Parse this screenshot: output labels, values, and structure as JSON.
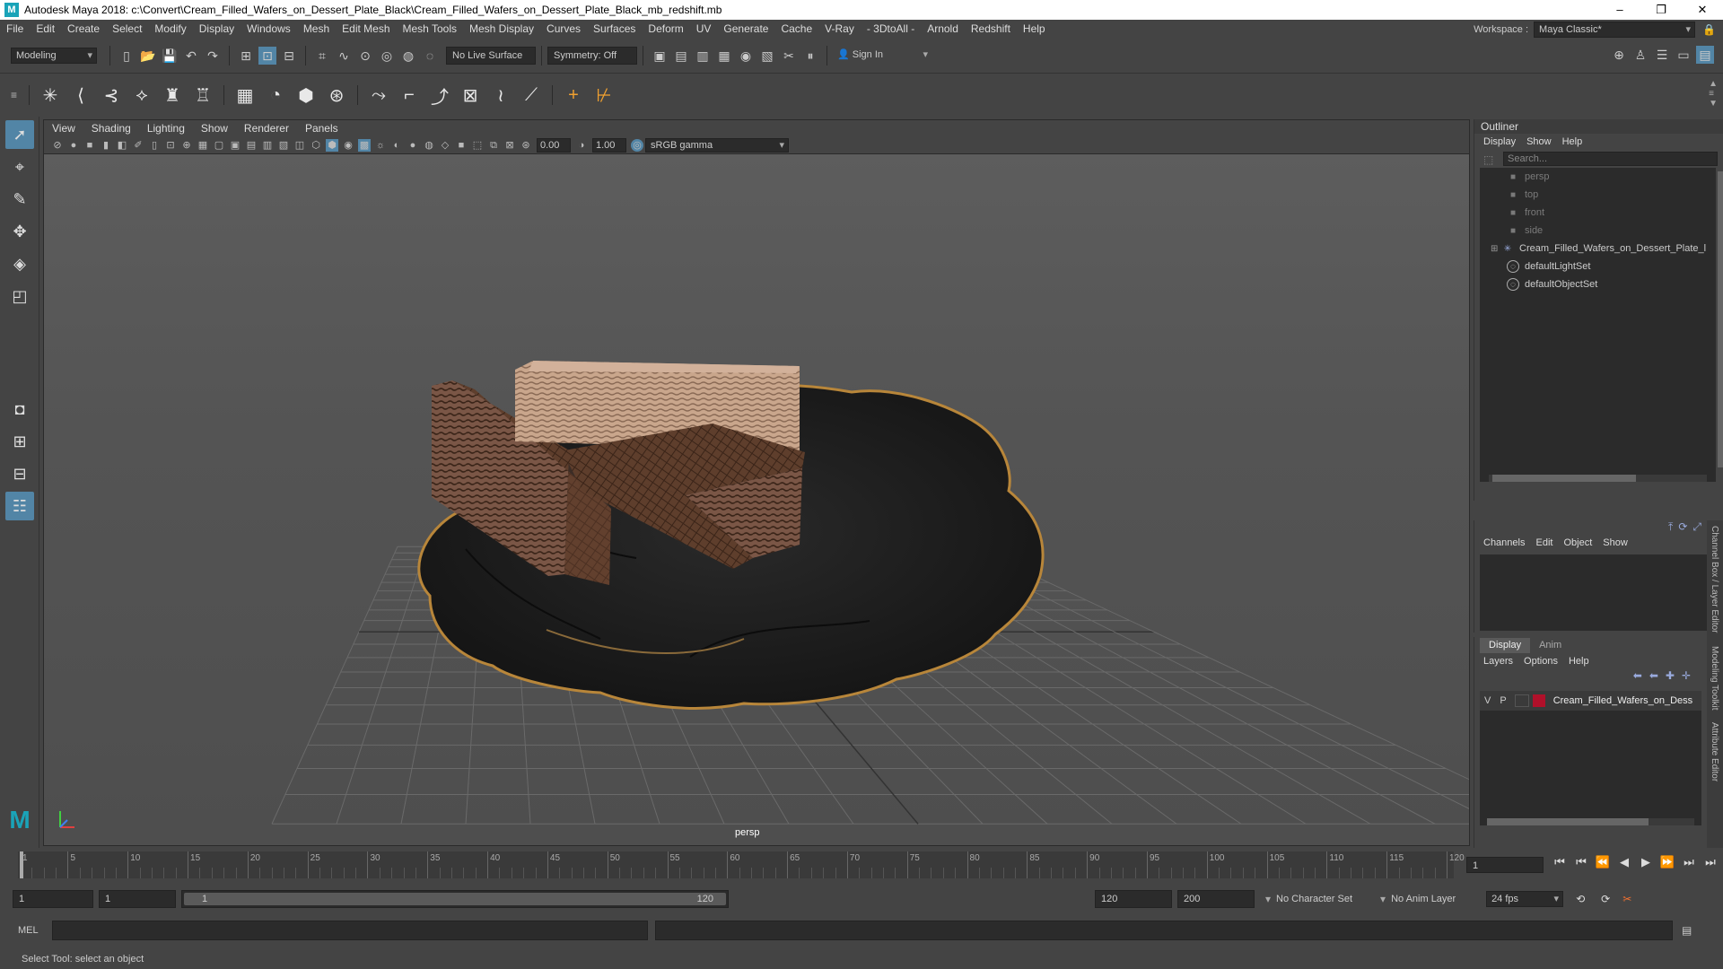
{
  "title_bar": {
    "title": "Autodesk Maya 2018: c:\\Convert\\Cream_Filled_Wafers_on_Dessert_Plate_Black\\Cream_Filled_Wafers_on_Dessert_Plate_Black_mb_redshift.mb",
    "minimize": "–",
    "maximize": "❐",
    "close": "✕"
  },
  "menubar": {
    "items": [
      "File",
      "Edit",
      "Create",
      "Select",
      "Modify",
      "Display",
      "Windows",
      "Mesh",
      "Edit Mesh",
      "Mesh Tools",
      "Mesh Display",
      "Curves",
      "Surfaces",
      "Deform",
      "UV",
      "Generate",
      "Cache",
      "V-Ray",
      "- 3DtoAll -",
      "Arnold",
      "Redshift",
      "Help"
    ],
    "workspace_label": "Workspace :",
    "workspace_value": "Maya Classic*"
  },
  "status_line": {
    "menuset": "Modeling",
    "live_surface": "No Live Surface",
    "symmetry": "Symmetry: Off",
    "sign_in": "Sign In"
  },
  "viewport": {
    "menu": [
      "View",
      "Shading",
      "Lighting",
      "Show",
      "Renderer",
      "Panels"
    ],
    "exposure": "0.00",
    "gamma": "1.00",
    "color_space": "sRGB gamma",
    "camera_label": "persp"
  },
  "outliner": {
    "title": "Outliner",
    "menu": [
      "Display",
      "Show",
      "Help"
    ],
    "search_placeholder": "Search...",
    "items": [
      {
        "label": "persp",
        "icon": "camera-icon"
      },
      {
        "label": "top",
        "icon": "camera-icon"
      },
      {
        "label": "front",
        "icon": "camera-icon"
      },
      {
        "label": "side",
        "icon": "camera-icon"
      },
      {
        "label": "Cream_Filled_Wafers_on_Dessert_Plate_l",
        "icon": "group-icon"
      },
      {
        "label": "defaultLightSet",
        "icon": "set-icon"
      },
      {
        "label": "defaultObjectSet",
        "icon": "set-icon"
      }
    ]
  },
  "channel_box": {
    "menu": [
      "Channels",
      "Edit",
      "Object",
      "Show"
    ]
  },
  "layer_editor": {
    "tabs": [
      "Display",
      "Anim"
    ],
    "menu": [
      "Layers",
      "Options",
      "Help"
    ],
    "layer": {
      "v": "V",
      "p": "P",
      "name": "Cream_Filled_Wafers_on_Dess",
      "color": "#b0102a"
    }
  },
  "side_tabs": [
    "Channel Box / Layer Editor",
    "Modeling Toolkit",
    "Attribute Editor"
  ],
  "time_slider": {
    "ticks": [
      1,
      5,
      10,
      15,
      20,
      25,
      30,
      35,
      40,
      45,
      50,
      55,
      60,
      65,
      70,
      75,
      80,
      85,
      90,
      95,
      100,
      105,
      110,
      115,
      120
    ],
    "current_frame": "1"
  },
  "range": {
    "start": "1",
    "playback_start": "1",
    "slider_start": "1",
    "slider_end": "120",
    "playback_end": "120",
    "end": "200",
    "character_set": "No Character Set",
    "anim_layer": "No Anim Layer",
    "fps": "24 fps"
  },
  "command_line": {
    "label": "MEL"
  },
  "help_line": {
    "text": "Select Tool: select an object"
  },
  "colors": {
    "accent": "#5285a6",
    "plate_rim": "#b8863a",
    "wafer_dark": "#5a3a2a",
    "wafer_light": "#c8a48a"
  }
}
